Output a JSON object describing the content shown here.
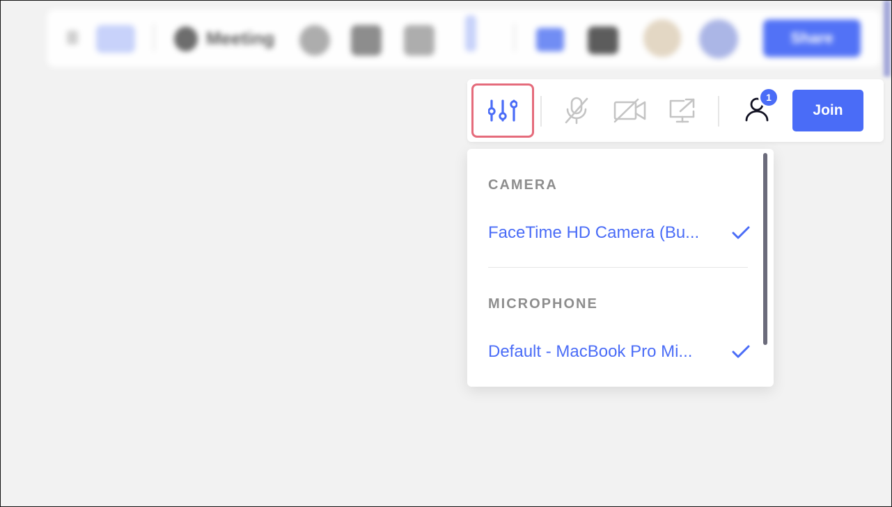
{
  "background_toolbar": {
    "meeting_label": "Meeting",
    "join_label": "Share"
  },
  "control_bar": {
    "settings_button": "settings-sliders",
    "mic_button": "mic-off",
    "camera_button": "camera-off",
    "share_button": "screen-share",
    "participants_count": "1",
    "join_label": "Join"
  },
  "dropdown": {
    "camera_section": "CAMERA",
    "camera_option": "FaceTime HD Camera (Bu...",
    "microphone_section": "MICROPHONE",
    "microphone_option": "Default - MacBook Pro Mi..."
  },
  "colors": {
    "accent": "#4a6cf7",
    "highlight_border": "#e56b7b",
    "section_text": "#8d8d8d",
    "disabled_icon": "#c4c4c4"
  }
}
